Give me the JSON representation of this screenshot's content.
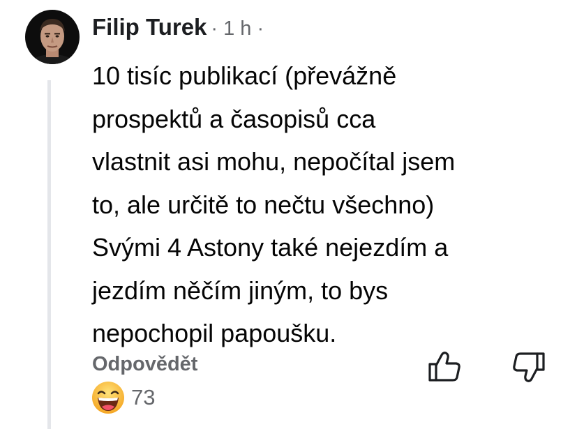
{
  "comment": {
    "author": "Filip Turek",
    "meta": "· 1 h ·",
    "lines": [
      "10 tisíc publikací (převážně",
      "prospektů a časopisů cca",
      "vlastnit asi mohu, nepočítal jsem",
      "to, ale určitě to nečtu všechno)",
      "Svými 4 Astony také nejezdím a",
      "jezdím něčím jiným, to bys",
      "nepochopil papoušku."
    ],
    "reply_label": "Odpovědět",
    "reaction_icon": "laughing-emoji-icon",
    "reaction_count": "73"
  },
  "colors": {
    "text": "#050505",
    "secondary": "#65676b",
    "thread_line": "#e4e6ea",
    "emoji_yellow": "#f7b928"
  }
}
